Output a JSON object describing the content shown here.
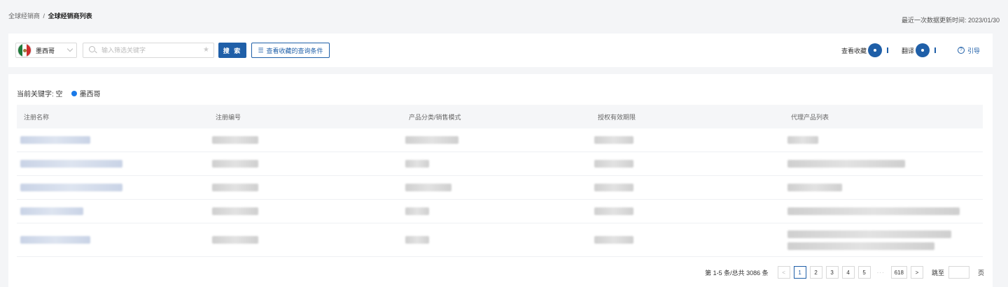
{
  "breadcrumb": {
    "parent": "全球经销商",
    "separator": "/",
    "current": "全球经销商列表"
  },
  "updated_text": "最近一次数据更新时间: 2023/01/30",
  "filters": {
    "country": "墨西哥",
    "search_placeholder": "输入筛选关键字",
    "search_value": "",
    "search_button": "搜 索",
    "saved_conditions_button": "查看收藏的查询条件"
  },
  "toggles": {
    "favorites_label": "查看收藏",
    "translate_label": "翻译",
    "guide_label": "引导"
  },
  "keyword_line": {
    "label": "当前关键字: 空",
    "tag": "墨西哥"
  },
  "table": {
    "columns": [
      "注册名称",
      "注册编号",
      "产品分类/销售模式",
      "授权有效期限",
      "代理产品列表"
    ]
  },
  "pagination": {
    "summary": "第 1-5 条/总共 3086 条",
    "prev": "<",
    "next": ">",
    "pages": [
      "1",
      "2",
      "3",
      "4",
      "5"
    ],
    "ellipsis": "···",
    "last_page": "618",
    "current_page": "1",
    "jump_label": "跳至",
    "page_suffix": "页"
  },
  "colors": {
    "primary": "#1f5fa8",
    "tag_dot": "#1a7ae8",
    "page_bg": "#f4f5f7"
  },
  "icons": {
    "flag": "mexico-flag-icon",
    "search": "search-icon",
    "star": "star-icon",
    "list": "list-icon",
    "guide": "question-circle-icon"
  }
}
